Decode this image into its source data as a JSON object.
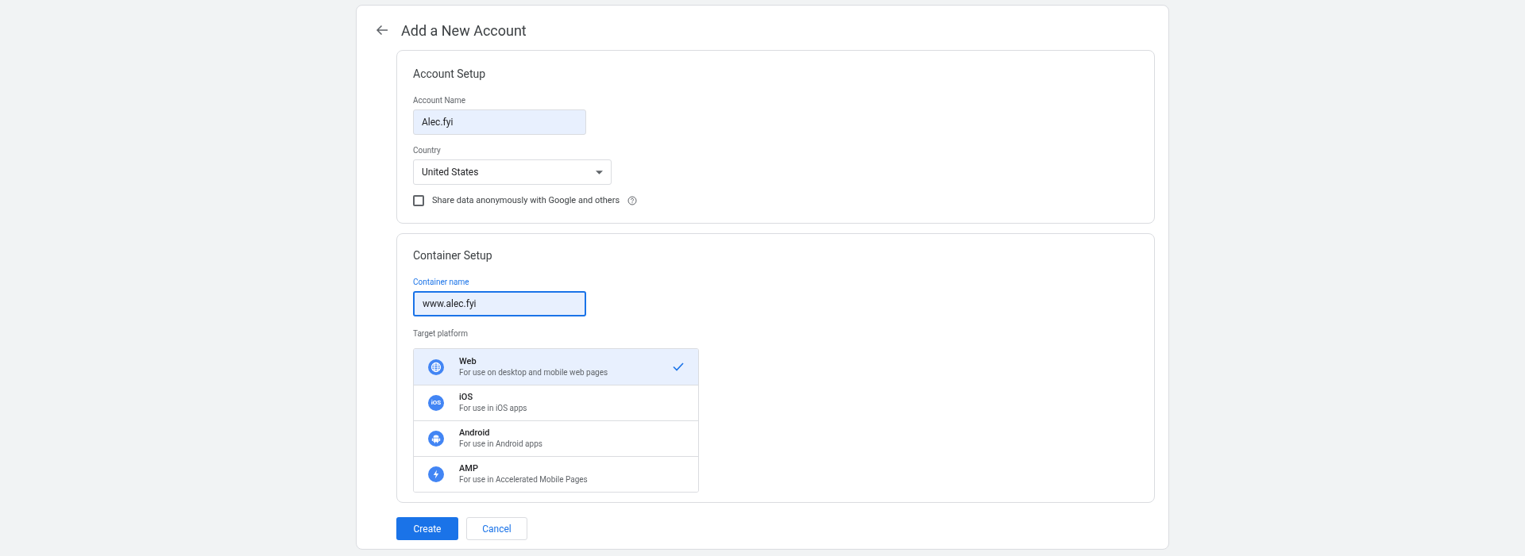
{
  "page": {
    "title": "Add a New Account"
  },
  "account_setup": {
    "heading": "Account Setup",
    "account_name": {
      "label": "Account Name",
      "value": "Alec.fyi"
    },
    "country": {
      "label": "Country",
      "value": "United States"
    },
    "share_data": {
      "label": "Share data anonymously with Google and others",
      "checked": false
    }
  },
  "container_setup": {
    "heading": "Container Setup",
    "container_name": {
      "label": "Container name",
      "value": "www.alec.fyi",
      "focused": true
    },
    "target_platform_label": "Target platform",
    "platforms": [
      {
        "kind": "web",
        "name": "Web",
        "description": "For use on desktop and mobile web pages",
        "selected": true
      },
      {
        "kind": "ios",
        "badge": "iOS",
        "name": "iOS",
        "description": "For use in iOS apps",
        "selected": false
      },
      {
        "kind": "android",
        "name": "Android",
        "description": "For use in Android apps",
        "selected": false
      },
      {
        "kind": "amp",
        "name": "AMP",
        "description": "For use in Accelerated Mobile Pages",
        "selected": false
      }
    ]
  },
  "buttons": {
    "create": "Create",
    "cancel": "Cancel"
  }
}
